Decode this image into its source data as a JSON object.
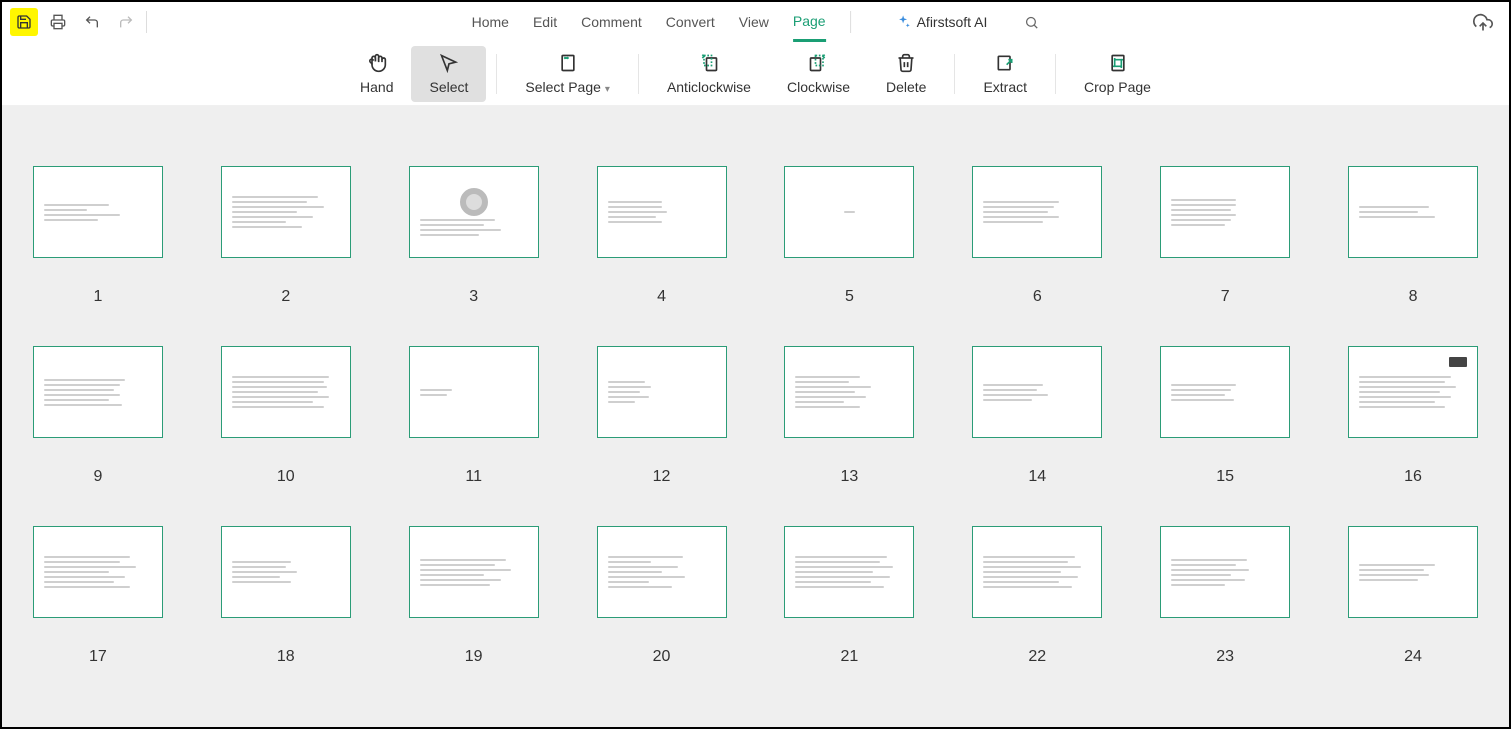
{
  "menu": {
    "home": "Home",
    "edit": "Edit",
    "comment": "Comment",
    "convert": "Convert",
    "view": "View",
    "page": "Page"
  },
  "ai_label": "Afirstsoft AI",
  "toolbar": {
    "hand": "Hand",
    "select": "Select",
    "select_page": "Select Page",
    "anticlockwise": "Anticlockwise",
    "clockwise": "Clockwise",
    "delete": "Delete",
    "extract": "Extract",
    "crop_page": "Crop Page"
  },
  "pages": [
    {
      "num": "1"
    },
    {
      "num": "2"
    },
    {
      "num": "3"
    },
    {
      "num": "4"
    },
    {
      "num": "5"
    },
    {
      "num": "6"
    },
    {
      "num": "7"
    },
    {
      "num": "8"
    },
    {
      "num": "9"
    },
    {
      "num": "10"
    },
    {
      "num": "11"
    },
    {
      "num": "12"
    },
    {
      "num": "13"
    },
    {
      "num": "14"
    },
    {
      "num": "15"
    },
    {
      "num": "16"
    },
    {
      "num": "17"
    },
    {
      "num": "18"
    },
    {
      "num": "19"
    },
    {
      "num": "20"
    },
    {
      "num": "21"
    },
    {
      "num": "22"
    },
    {
      "num": "23"
    },
    {
      "num": "24"
    }
  ],
  "colors": {
    "accent": "#1a9e74",
    "highlight": "#fff600"
  }
}
